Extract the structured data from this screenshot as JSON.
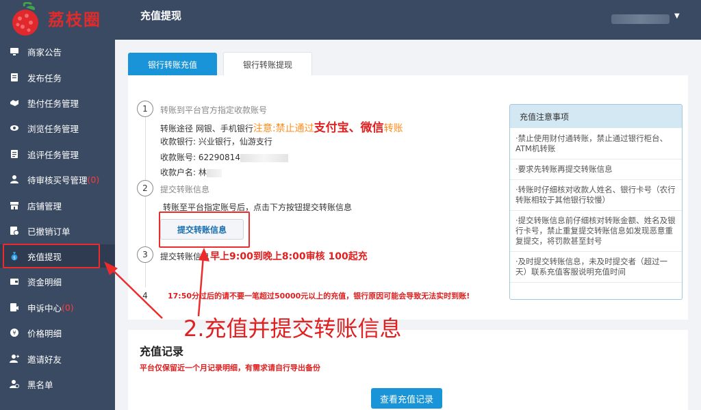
{
  "app": {
    "logo_text": "荔枝圈",
    "page_title": "充值提现"
  },
  "sidebar": {
    "items": [
      {
        "label": "商家公告",
        "badge": ""
      },
      {
        "label": "发布任务",
        "badge": ""
      },
      {
        "label": "垫付任务管理",
        "badge": ""
      },
      {
        "label": "浏览任务管理",
        "badge": ""
      },
      {
        "label": "追评任务管理",
        "badge": ""
      },
      {
        "label": "待审核买号管理",
        "badge": "(0)"
      },
      {
        "label": "店铺管理",
        "badge": ""
      },
      {
        "label": "已撤销订单",
        "badge": ""
      },
      {
        "label": "充值提现",
        "badge": ""
      },
      {
        "label": "资金明细",
        "badge": ""
      },
      {
        "label": "申诉中心",
        "badge": "(0)"
      },
      {
        "label": "价格明细",
        "badge": ""
      },
      {
        "label": "邀请好友",
        "badge": ""
      },
      {
        "label": "黑名单",
        "badge": ""
      }
    ]
  },
  "tabs": {
    "active": "银行转账充值",
    "other": "银行转账提现"
  },
  "steps": {
    "s1": {
      "num": "1",
      "title": "转账到平台官方指定收款账号",
      "route_label": "转账途径",
      "route_value": "网银、手机银行",
      "warning_prefix": "注意:禁止通过",
      "warning_bold": "支付宝、微信",
      "warning_suffix": "转账",
      "bank_label": "收款银行:",
      "bank_value": "兴业银行，仙游支行",
      "account_label": "收款账号:",
      "account_value": "62290814",
      "name_label": "收款户名:",
      "name_value": "林"
    },
    "s2": {
      "num": "2",
      "title": "提交转账信息",
      "desc": "转账至平台指定账号后，点击下方按钮提交转账信息",
      "button": "提交转账信息"
    },
    "s3": {
      "num": "3",
      "title": "提交转账信息",
      "time_text": "早上9:00到晚上8:00审核  100起充"
    },
    "s4": {
      "num": "4",
      "warning": "17:50分过后的请不要一笔超过50000元以上的充值，银行原因可能会导致无法实时到账!"
    }
  },
  "notes": {
    "title": "充值注意事项",
    "items": [
      "·禁止使用财付通转账，禁止通过银行柜台、ATM机转账",
      "·要求先转账再提交转账信息",
      "·转账时仔细核对收款人姓名、银行卡号（农行转账相较于其他银行较慢）",
      "·提交转账信息前仔细核对转账金额、姓名及银行卡号，禁止重复提交转账信息如发现恶意重复提交，将罚款甚至封号",
      "·及时提交转账信息，未及时提交者（超过一天）联系充值客服说明充值时间"
    ]
  },
  "annotation": "2.充值并提交转账信息",
  "records": {
    "title": "充值记录",
    "subtitle": "平台仅保留近一个月记录明细，有需求请自行导出备份",
    "button": "查看充值记录"
  },
  "colors": {
    "sidebar_bg": "#3a4a63",
    "accent": "#1a94d8",
    "warning_red": "#e02020",
    "warning_orange": "#ff8c1a"
  }
}
